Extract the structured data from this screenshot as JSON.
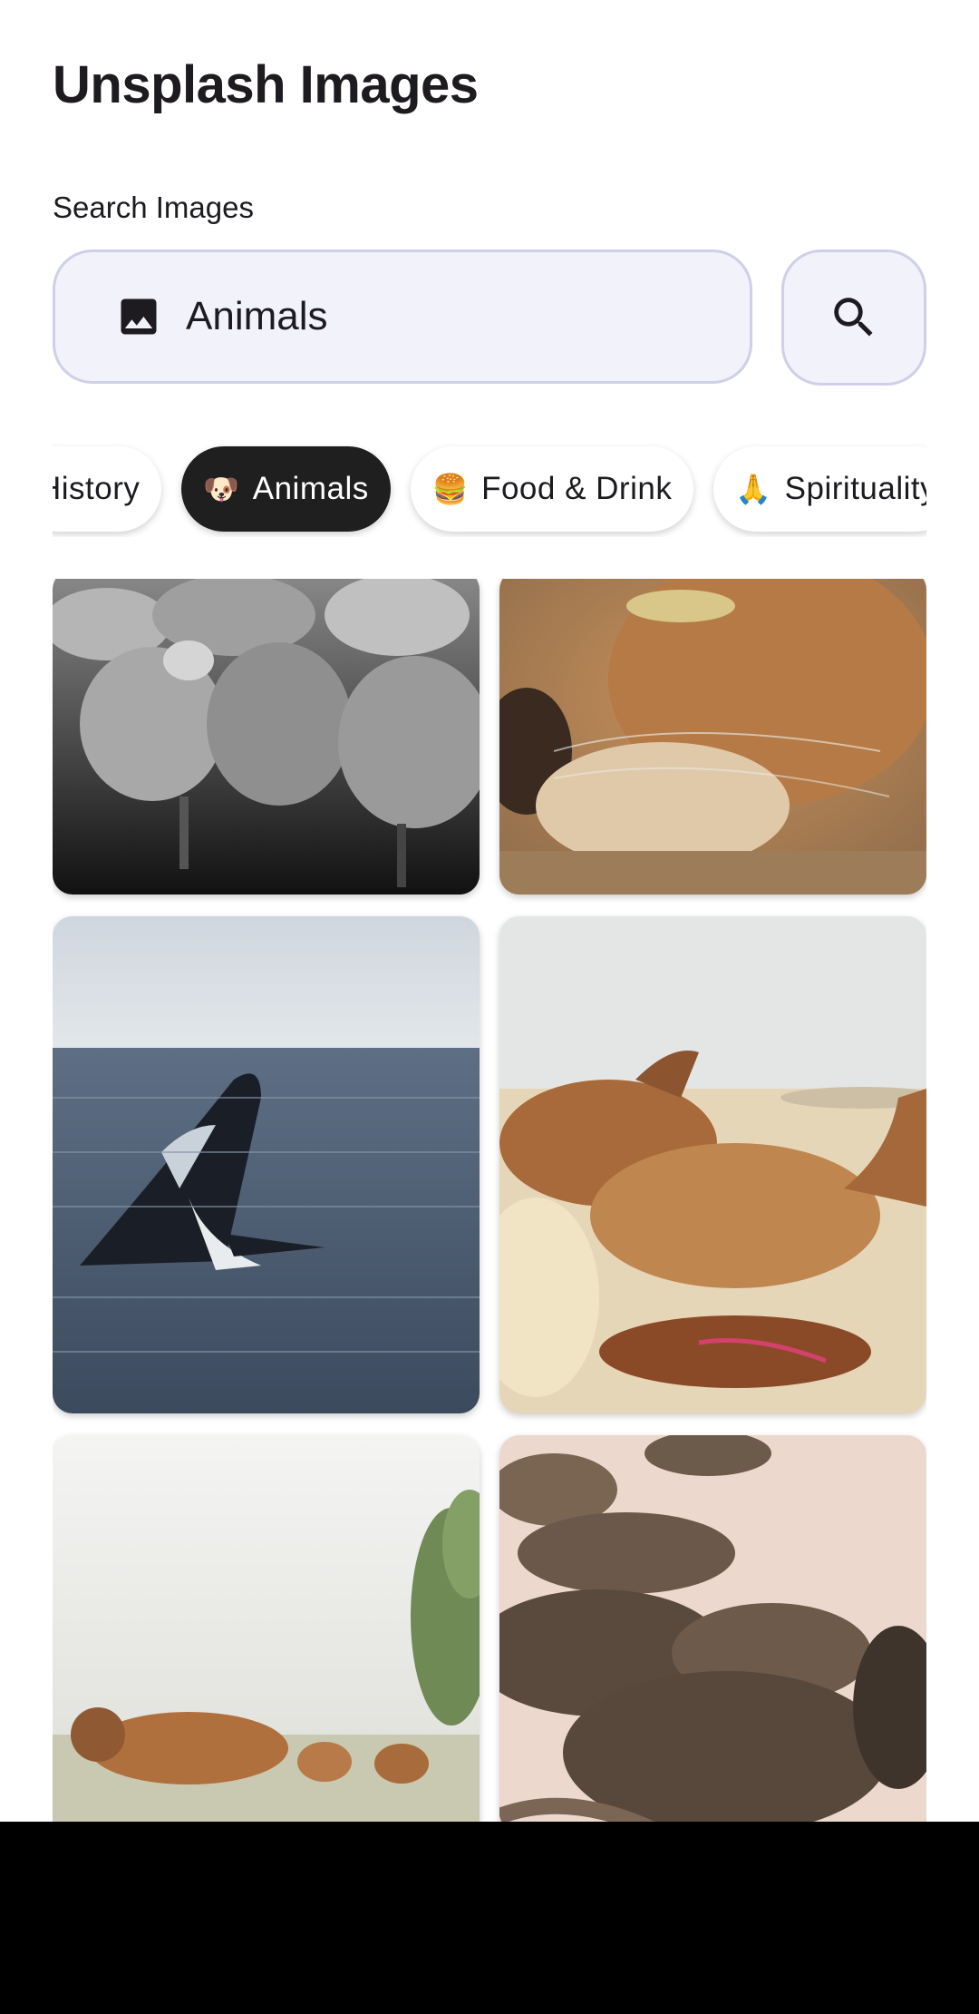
{
  "app": {
    "title": "Unsplash Images"
  },
  "search": {
    "label": "Search Images",
    "value": "Animals",
    "field_icon": "image-icon",
    "button_icon": "search-icon"
  },
  "categories": [
    {
      "emoji": "",
      "label": "History",
      "selected": false
    },
    {
      "emoji": "🐶",
      "label": "Animals",
      "selected": true
    },
    {
      "emoji": "🍔",
      "label": "Food & Drink",
      "selected": false
    },
    {
      "emoji": "🙏",
      "label": "Spirituality",
      "selected": false
    }
  ],
  "images": [
    {
      "subject": "flock of sheep"
    },
    {
      "subject": "fox close-up"
    },
    {
      "subject": "breaching whale"
    },
    {
      "subject": "camels resting in desert"
    },
    {
      "subject": "cows in foggy field"
    },
    {
      "subject": "iguanas on sand"
    }
  ],
  "colors": {
    "accent_bg": "#f2f2fb",
    "accent_border": "#cfcfe8",
    "chip_selected": "#1f1f1f"
  }
}
